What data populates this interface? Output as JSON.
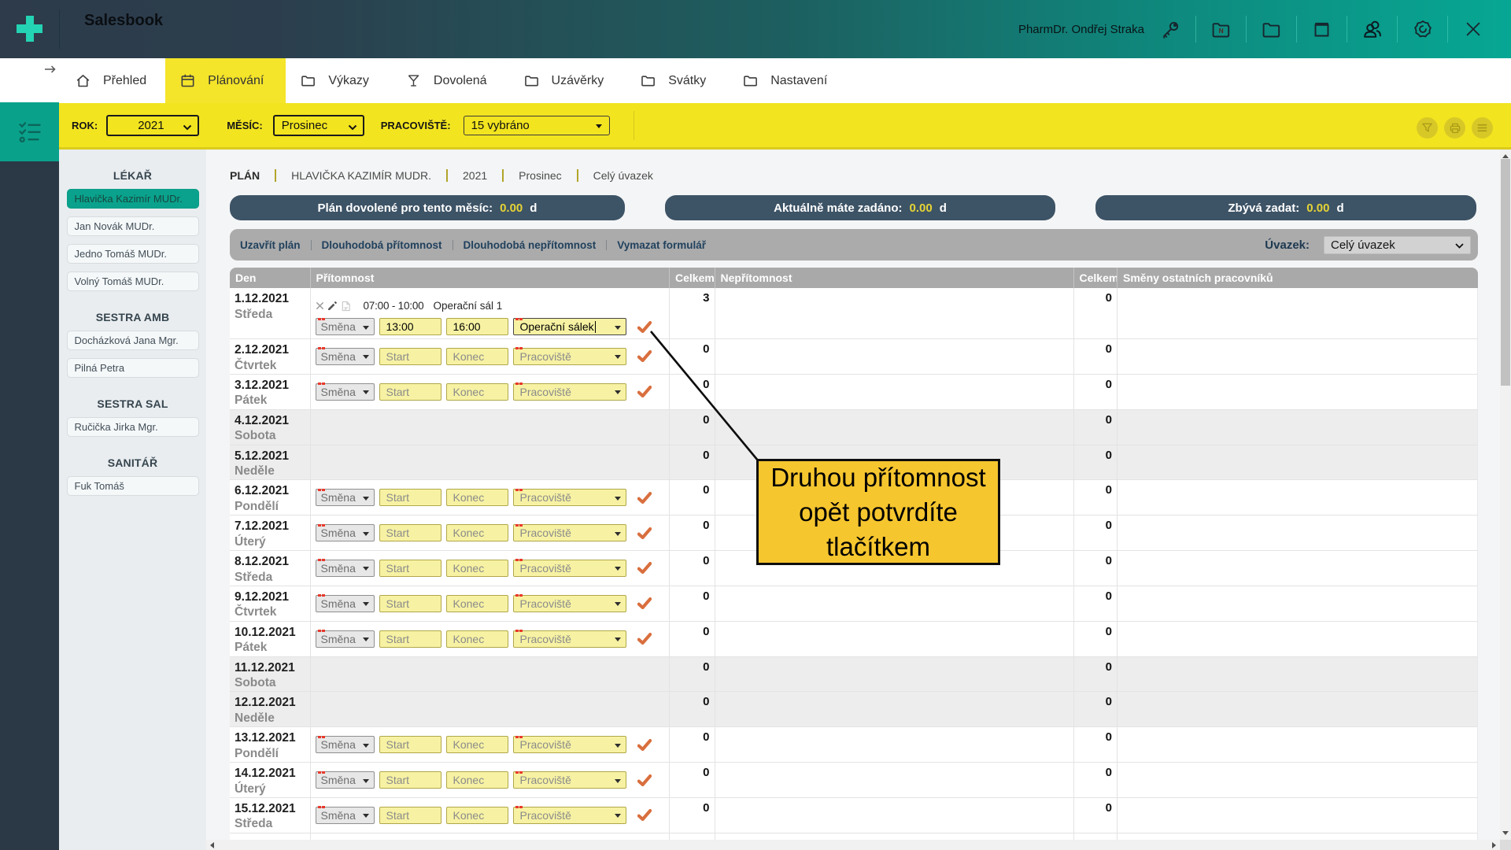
{
  "app": {
    "title": "Salesbook",
    "user": "PharmDr. Ondřej Straka"
  },
  "header_icons": [
    {
      "name": "key-icon"
    },
    {
      "name": "folder-note-icon"
    },
    {
      "name": "folder-icon"
    },
    {
      "name": "window-icon"
    },
    {
      "name": "users-icon"
    },
    {
      "name": "settings-icon"
    },
    {
      "name": "close-icon"
    }
  ],
  "tabs": [
    {
      "id": "prehled",
      "label": "Přehled",
      "icon": "home",
      "active": false
    },
    {
      "id": "planovani",
      "label": "Plánování",
      "icon": "calendar",
      "active": true
    },
    {
      "id": "vykazy",
      "label": "Výkazy",
      "icon": "folder",
      "active": false
    },
    {
      "id": "dovolena",
      "label": "Dovolená",
      "icon": "martini",
      "active": false
    },
    {
      "id": "uzaverky",
      "label": "Uzávěrky",
      "icon": "folder",
      "active": false
    },
    {
      "id": "svatky",
      "label": "Svátky",
      "icon": "folder",
      "active": false
    },
    {
      "id": "nastaveni",
      "label": "Nastavení",
      "icon": "folder",
      "active": false
    }
  ],
  "filters": {
    "rok": {
      "label": "ROK:",
      "value": "2021"
    },
    "mesic": {
      "label": "MĚSÍC:",
      "value": "Prosinec"
    },
    "pracoviste": {
      "label": "PRACOVIŠTĚ:",
      "value": "15 vybráno"
    }
  },
  "filter_actions": [
    {
      "name": "filter-icon"
    },
    {
      "name": "print-icon"
    },
    {
      "name": "menu-icon"
    }
  ],
  "sidebar": {
    "groups": [
      {
        "title": "LÉKAŘ",
        "items": [
          {
            "label": "Hlavička Kazimír MUDr.",
            "selected": true
          },
          {
            "label": "Jan Novák MUDr.",
            "selected": false
          },
          {
            "label": "Jedno Tomáš MUDr.",
            "selected": false
          },
          {
            "label": "Volný Tomáš MUDr.",
            "selected": false
          }
        ]
      },
      {
        "title": "SESTRA AMB",
        "items": [
          {
            "label": "Docházková Jana Mgr.",
            "selected": false
          },
          {
            "label": "Pilná Petra",
            "selected": false
          }
        ]
      },
      {
        "title": "SESTRA SAL",
        "items": [
          {
            "label": "Ručička Jirka Mgr.",
            "selected": false
          }
        ]
      },
      {
        "title": "SANITÁŘ",
        "items": [
          {
            "label": "Fuk Tomáš",
            "selected": false
          }
        ]
      }
    ]
  },
  "breadcrumb": [
    "PLÁN",
    "HLAVIČKA KAZIMÍR MUDR.",
    "2021",
    "Prosinec",
    "Celý úvazek"
  ],
  "pills": [
    {
      "label": "Plán dovolené pro tento měsíc:",
      "value": "0.00",
      "unit": "d"
    },
    {
      "label": "Aktuálně máte zadáno:",
      "value": "0.00",
      "unit": "d"
    },
    {
      "label": "Zbývá zadat:",
      "value": "0.00",
      "unit": "d"
    }
  ],
  "toolbar": {
    "buttons": [
      "Uzavřít plán",
      "Dlouhodobá přítomnost",
      "Dlouhodobá nepřítomnost",
      "Vymazat formulář"
    ],
    "uvazek_label": "Úvazek:",
    "uvazek_value": "Celý úvazek"
  },
  "table": {
    "headers": [
      "Den",
      "Přítomnost",
      "Celkem",
      "Nepřítomnost",
      "Celkem",
      "Směny ostatních pracovníků"
    ],
    "form": {
      "smena": "Směna",
      "start": "Start",
      "konec": "Konec",
      "pracoviste": "Pracoviště"
    },
    "rows": [
      {
        "date": "1.12.2021",
        "day": "Středa",
        "type": "entry",
        "celkem": "3",
        "celkem2": "0",
        "entry": {
          "time": "07:00 -  10:00",
          "place": "Operační sál 1"
        },
        "form": {
          "start": "13:00",
          "konec": "16:00",
          "pracoviste": "Operační sálek"
        }
      },
      {
        "date": "2.12.2021",
        "day": "Čtvrtek",
        "type": "form",
        "celkem": "0",
        "celkem2": "0"
      },
      {
        "date": "3.12.2021",
        "day": "Pátek",
        "type": "form",
        "celkem": "0",
        "celkem2": "0"
      },
      {
        "date": "4.12.2021",
        "day": "Sobota",
        "type": "empty",
        "celkem": "0",
        "celkem2": "0"
      },
      {
        "date": "5.12.2021",
        "day": "Neděle",
        "type": "empty",
        "celkem": "0",
        "celkem2": "0"
      },
      {
        "date": "6.12.2021",
        "day": "Pondělí",
        "type": "form",
        "celkem": "0",
        "celkem2": "0"
      },
      {
        "date": "7.12.2021",
        "day": "Úterý",
        "type": "form",
        "celkem": "0",
        "celkem2": "0"
      },
      {
        "date": "8.12.2021",
        "day": "Středa",
        "type": "form",
        "celkem": "0",
        "celkem2": "0"
      },
      {
        "date": "9.12.2021",
        "day": "Čtvrtek",
        "type": "form",
        "celkem": "0",
        "celkem2": "0"
      },
      {
        "date": "10.12.2021",
        "day": "Pátek",
        "type": "form",
        "celkem": "0",
        "celkem2": "0"
      },
      {
        "date": "11.12.2021",
        "day": "Sobota",
        "type": "empty",
        "celkem": "0",
        "celkem2": "0"
      },
      {
        "date": "12.12.2021",
        "day": "Neděle",
        "type": "empty",
        "celkem": "0",
        "celkem2": "0"
      },
      {
        "date": "13.12.2021",
        "day": "Pondělí",
        "type": "form",
        "celkem": "0",
        "celkem2": "0"
      },
      {
        "date": "14.12.2021",
        "day": "Úterý",
        "type": "form",
        "celkem": "0",
        "celkem2": "0"
      },
      {
        "date": "15.12.2021",
        "day": "Středa",
        "type": "form",
        "celkem": "0",
        "celkem2": "0"
      }
    ]
  },
  "annotation": {
    "lines": [
      "Druhou přítomnost",
      "opět potvrdíte",
      "tlačítkem"
    ]
  },
  "colors": {
    "teal": "#0aa18b",
    "yellow": "#f2e41f",
    "topbar_left": "#2d3b4a",
    "topbar_right": "#07a794",
    "pill": "#3d5366",
    "pill_value": "#e5d435",
    "callout": "#f6c62f",
    "check": "#d96f3e",
    "selected_item": "#0aa28c",
    "header_gray": "#a9a9a9"
  }
}
